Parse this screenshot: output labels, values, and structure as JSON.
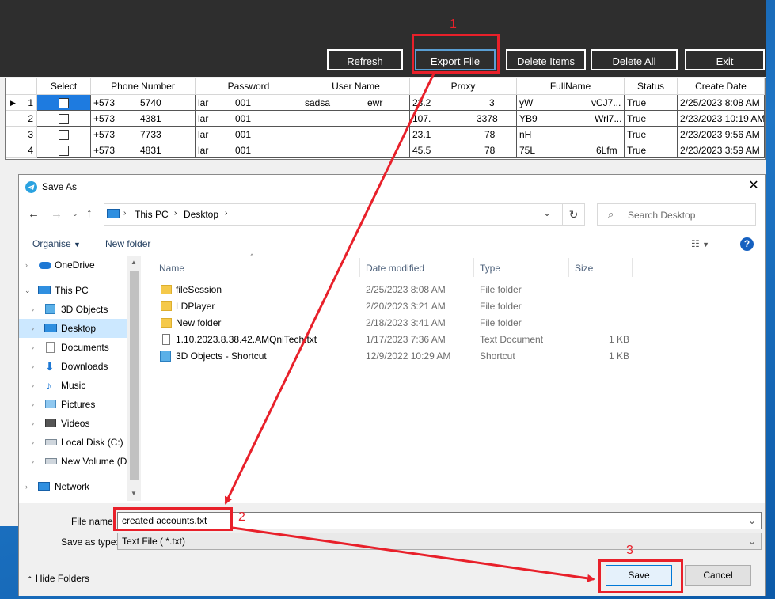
{
  "toolbar": {
    "refresh": "Refresh",
    "export": "Export File",
    "delete_items": "Delete Items",
    "delete_all": "Delete All",
    "exit": "Exit"
  },
  "grid": {
    "headers": [
      "Select",
      "Phone Number",
      "Password",
      "User Name",
      "Proxy",
      "FullName",
      "Status",
      "Create Date"
    ],
    "rows": [
      {
        "n": "1",
        "phone_a": "+573",
        "phone_b": "5740",
        "pw_a": "lar",
        "pw_b": "001",
        "user_a": "sadsa",
        "user_b": "ewr",
        "proxy_a": "23.2",
        "proxy_b": "3",
        "name_a": "yW",
        "name_b": "vCJ7...",
        "status": "True",
        "date": "2/25/2023 8:08 AM"
      },
      {
        "n": "2",
        "phone_a": "+573",
        "phone_b": "4381",
        "pw_a": "lar",
        "pw_b": "001",
        "user_a": "",
        "user_b": "",
        "proxy_a": "107.",
        "proxy_b": "3378",
        "name_a": "YB9",
        "name_b": "Wrl7...",
        "status": "True",
        "date": "2/23/2023 10:19 AM"
      },
      {
        "n": "3",
        "phone_a": "+573",
        "phone_b": "7733",
        "pw_a": "lar",
        "pw_b": "001",
        "user_a": "",
        "user_b": "",
        "proxy_a": "23.1",
        "proxy_b": "78",
        "name_a": "nH",
        "name_b": "",
        "status": "True",
        "date": "2/23/2023 9:56 AM"
      },
      {
        "n": "4",
        "phone_a": "+573",
        "phone_b": "4831",
        "pw_a": "lar",
        "pw_b": "001",
        "user_a": "",
        "user_b": "",
        "proxy_a": "45.5",
        "proxy_b": "78",
        "name_a": "75L",
        "name_b": "6Lfm",
        "status": "True",
        "date": "2/23/2023 3:59 AM"
      }
    ]
  },
  "dialog": {
    "title": "Save As",
    "breadcrumb": [
      "This PC",
      "Desktop"
    ],
    "search_placeholder": "Search Desktop",
    "organise": "Organise",
    "new_folder": "New folder",
    "nav": [
      "OneDrive",
      "This PC",
      "3D Objects",
      "Desktop",
      "Documents",
      "Downloads",
      "Music",
      "Pictures",
      "Videos",
      "Local Disk (C:)",
      "New Volume (D:",
      "Network"
    ],
    "columns": [
      "Name",
      "Date modified",
      "Type",
      "Size"
    ],
    "files": [
      {
        "name": "fileSession",
        "date": "2/25/2023 8:08 AM",
        "type": "File folder",
        "size": ""
      },
      {
        "name": "LDPlayer",
        "date": "2/20/2023 3:21 AM",
        "type": "File folder",
        "size": ""
      },
      {
        "name": "New folder",
        "date": "2/18/2023 3:41 AM",
        "type": "File folder",
        "size": ""
      },
      {
        "name": "1.10.2023.8.38.42.AMQniTech.txt",
        "date": "1/17/2023 7:36 AM",
        "type": "Text Document",
        "size": "1 KB"
      },
      {
        "name": "3D Objects - Shortcut",
        "date": "12/9/2022 10:29 AM",
        "type": "Shortcut",
        "size": "1 KB"
      }
    ],
    "file_name_label": "File name:",
    "file_name_value": "created accounts.txt",
    "save_type_label": "Save as type:",
    "save_type_value": "Text File  ( *.txt)",
    "hide_folders": "Hide Folders",
    "save": "Save",
    "cancel": "Cancel"
  },
  "annotations": [
    "1",
    "2",
    "3"
  ],
  "colors": {
    "annotation": "#e8202a",
    "selection": "#cce8ff",
    "app_dark": "#2e2e2e"
  }
}
